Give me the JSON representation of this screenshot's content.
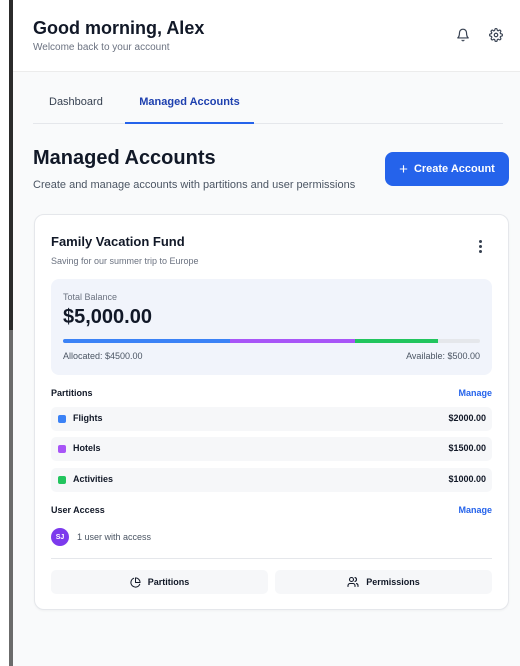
{
  "header": {
    "greeting": "Good morning, Alex",
    "subtitle": "Welcome back to your account",
    "icons": [
      "bell-icon",
      "gear-icon"
    ]
  },
  "tabs": [
    {
      "label": "Dashboard",
      "active": false
    },
    {
      "label": "Managed Accounts",
      "active": true
    }
  ],
  "page": {
    "title": "Managed Accounts",
    "subtitle": "Create and manage accounts with partitions and user permissions",
    "create_button": "Create Account",
    "accent_color": "#2563eb"
  },
  "account": {
    "name": "Family Vacation Fund",
    "description": "Saving for our summer trip to Europe",
    "balance_label": "Total Balance",
    "balance": "$5,000.00",
    "balance_value": 5000,
    "allocated_text": "Allocated: $4500.00",
    "available_text": "Available: $500.00",
    "partitions_label": "Partitions",
    "partitions_manage": "Manage",
    "partitions": [
      {
        "name": "Flights",
        "amount": "$2000.00",
        "value": 2000,
        "color": "#3b82f6"
      },
      {
        "name": "Hotels",
        "amount": "$1500.00",
        "value": 1500,
        "color": "#a855f7"
      },
      {
        "name": "Activities",
        "amount": "$1000.00",
        "value": 1000,
        "color": "#22c55e"
      }
    ],
    "user_access_label": "User Access",
    "user_access_manage": "Manage",
    "user_initials": "SJ",
    "user_access_text": "1 user with access",
    "footer_buttons": [
      {
        "label": "Partitions",
        "icon": "pie-chart-icon"
      },
      {
        "label": "Permissions",
        "icon": "users-icon"
      }
    ]
  }
}
